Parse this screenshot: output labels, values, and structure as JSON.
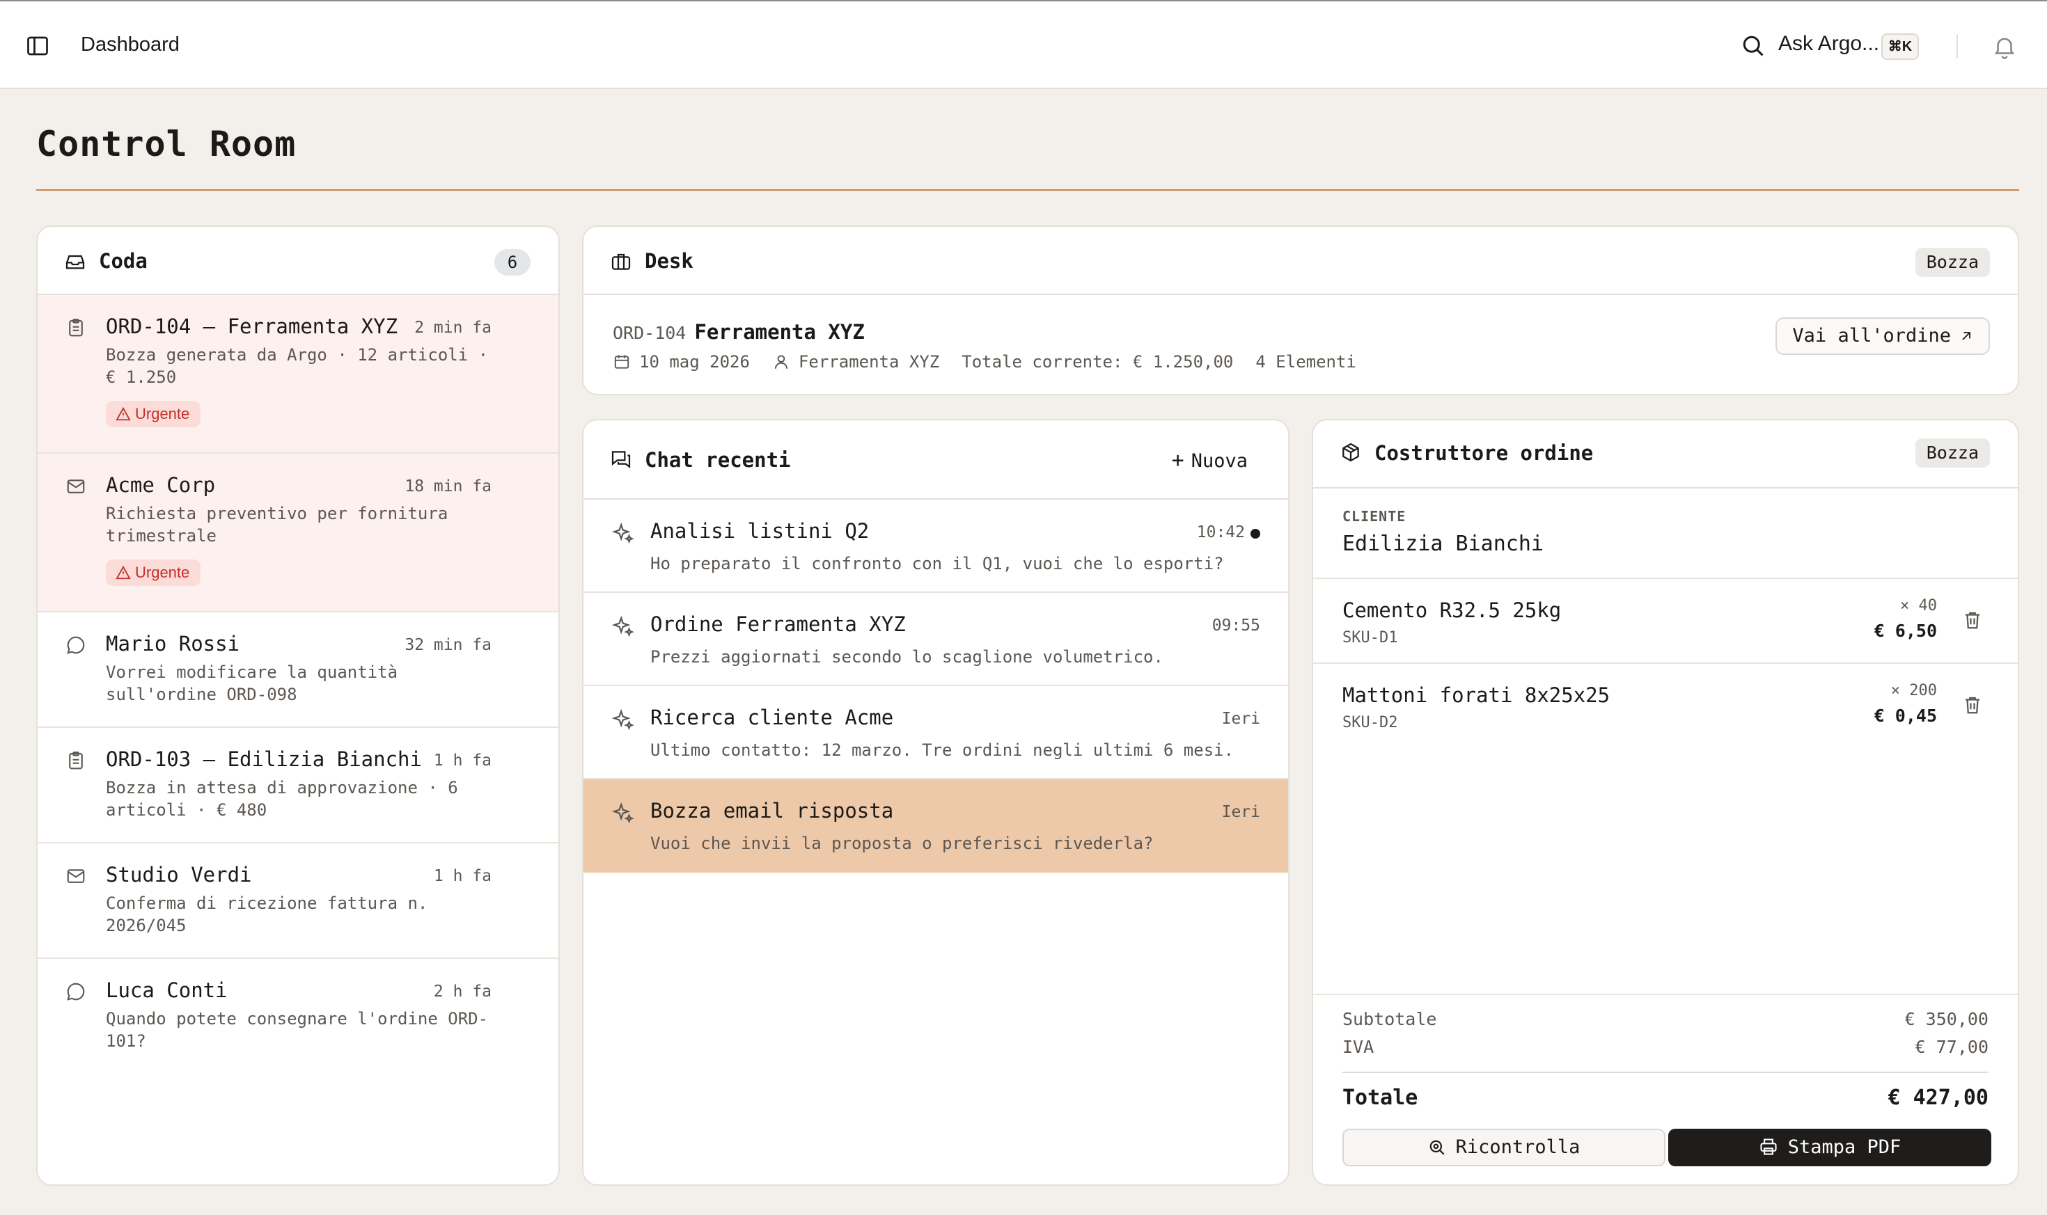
{
  "topbar": {
    "breadcrumb": "Dashboard",
    "ask_label": "Ask Argo...",
    "shortcut": "⌘K"
  },
  "page": {
    "title": "Control Room"
  },
  "queue": {
    "title": "Coda",
    "count": "6",
    "items": [
      {
        "icon": "clipboard-icon",
        "name": "ORD-104 — Ferramenta XYZ",
        "time": "2 min fa",
        "desc": "Bozza generata da Argo · 12 articoli · € 1.250",
        "tag": "Urgente"
      },
      {
        "icon": "mail-icon",
        "name": "Acme Corp",
        "time": "18 min fa",
        "desc": "Richiesta preventivo per fornitura trimestrale",
        "tag": "Urgente"
      },
      {
        "icon": "message-icon",
        "name": "Mario Rossi",
        "time": "32 min fa",
        "desc": "Vorrei modificare la quantità sull'ordine ORD-098"
      },
      {
        "icon": "clipboard-icon",
        "name": "ORD-103 — Edilizia Bianchi",
        "time": "1 h fa",
        "desc": "Bozza in attesa di approvazione · 6 articoli · € 480"
      },
      {
        "icon": "mail-icon",
        "name": "Studio Verdi",
        "time": "1 h fa",
        "desc": "Conferma di ricezione fattura n. 2026/045"
      },
      {
        "icon": "message-icon",
        "name": "Luca Conti",
        "time": "2 h fa",
        "desc": "Quando potete consegnare l'ordine ORD-101?"
      }
    ]
  },
  "desk": {
    "title": "Desk",
    "status": "Bozza",
    "order_id": "ORD-104",
    "order_name": "Ferramenta XYZ",
    "date": "10 mag 2026",
    "customer": "Ferramenta XYZ",
    "total": "Totale corrente: € 1.250,00",
    "elements": "4 Elementi",
    "goto_label": "Vai all'ordine"
  },
  "chat": {
    "title": "Chat recenti",
    "new_label": "Nuova",
    "items": [
      {
        "name": "Analisi listini Q2",
        "time": "10:42",
        "desc": "Ho preparato il confronto con il Q1, vuoi che lo esporti?",
        "unread": true
      },
      {
        "name": "Ordine Ferramenta XYZ",
        "time": "09:55",
        "desc": "Prezzi aggiornati secondo lo scaglione volumetrico."
      },
      {
        "name": "Ricerca cliente Acme",
        "time": "Ieri",
        "desc": "Ultimo contatto: 12 marzo. Tre ordini negli ultimi 6 mesi."
      },
      {
        "name": "Bozza email risposta",
        "time": "Ieri",
        "desc": "Vuoi che invii la proposta o preferisci rivederla?",
        "active": true
      }
    ]
  },
  "builder": {
    "title": "Costruttore ordine",
    "status": "Bozza",
    "client_label": "CLIENTE",
    "client_name": "Edilizia Bianchi",
    "lines": [
      {
        "name": "Cemento R32.5 25kg",
        "sku": "SKU-D1",
        "qty": "× 40",
        "price": "€ 6,50"
      },
      {
        "name": "Mattoni forati 8x25x25",
        "sku": "SKU-D2",
        "qty": "× 200",
        "price": "€ 0,45"
      }
    ],
    "subtotal_label": "Subtotale",
    "subtotal": "€ 350,00",
    "vat_label": "IVA",
    "vat": "€ 77,00",
    "total_label": "Totale",
    "total": "€ 427,00",
    "recheck_label": "Ricontrolla",
    "print_label": "Stampa PDF"
  },
  "colors": {
    "accent": "#c9834d",
    "active_chat": "#edc9aa",
    "urgent_bg": "#fdf1ef",
    "urgent_text": "#c6302a",
    "page_bg": "#f3f0ec"
  }
}
